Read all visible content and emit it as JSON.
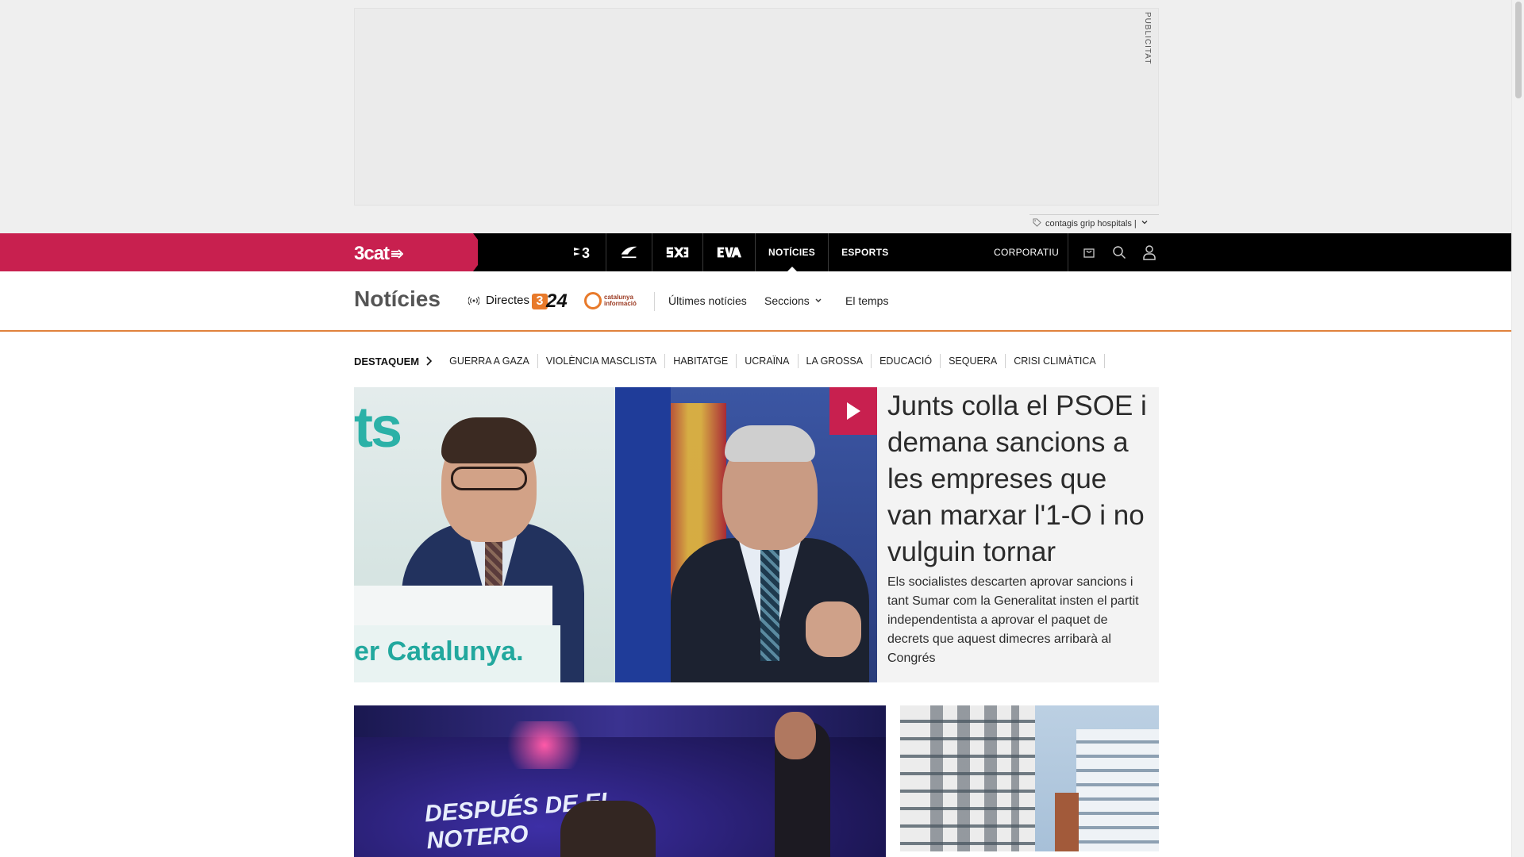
{
  "ad": {
    "label": "PUBLICITAT"
  },
  "tag": {
    "text": "contagis grip hospitals |"
  },
  "global_nav": {
    "brand": "3cat",
    "channels": [
      {
        "id": "tv3",
        "label": "3"
      },
      {
        "id": "catradio",
        "label": "Cat Ràdio"
      },
      {
        "id": "sx3",
        "label": "SX3"
      },
      {
        "id": "eva",
        "label": "EVA"
      },
      {
        "id": "noticies",
        "label": "NOTÍCIES",
        "active": true
      },
      {
        "id": "esports",
        "label": "ESPORTS"
      }
    ],
    "corporate": "CORPORATIU"
  },
  "section": {
    "title": "Notícies",
    "live_label": "Directes",
    "logo_324": "24",
    "logo_ci": "catalunya informació",
    "links": [
      "Últimes notícies",
      "Seccions",
      "El temps"
    ]
  },
  "highlights": {
    "label": "DESTAQUEM",
    "items": [
      "GUERRA A GAZA",
      "VIOLÈNCIA MASCLISTA",
      "HABITATGE",
      "UCRAÏNA",
      "LA GROSSA",
      "EDUCACIÓ",
      "SEQUERA",
      "CRISI CLIMÀTICA"
    ]
  },
  "main_story": {
    "title": "Junts colla el PSOE i demana sancions a les empreses que van marxar l'1-O i no vulguin tornar",
    "subtitle": "Els socialistes descarten aprovar sancions i tant Sumar com la Generalitat insten el partit independentista a aprovar el paquet de decrets que aquest dimecres arribarà al Congrés",
    "photo_text_top": "ts",
    "photo_text_bottom": "er Catalunya."
  },
  "story2": {
    "overlay_text": "DESPUÉS DE EL NOTERO"
  },
  "colors": {
    "brand": "#c8204f",
    "accent": "#e0823d",
    "nav_bg": "#000000"
  }
}
